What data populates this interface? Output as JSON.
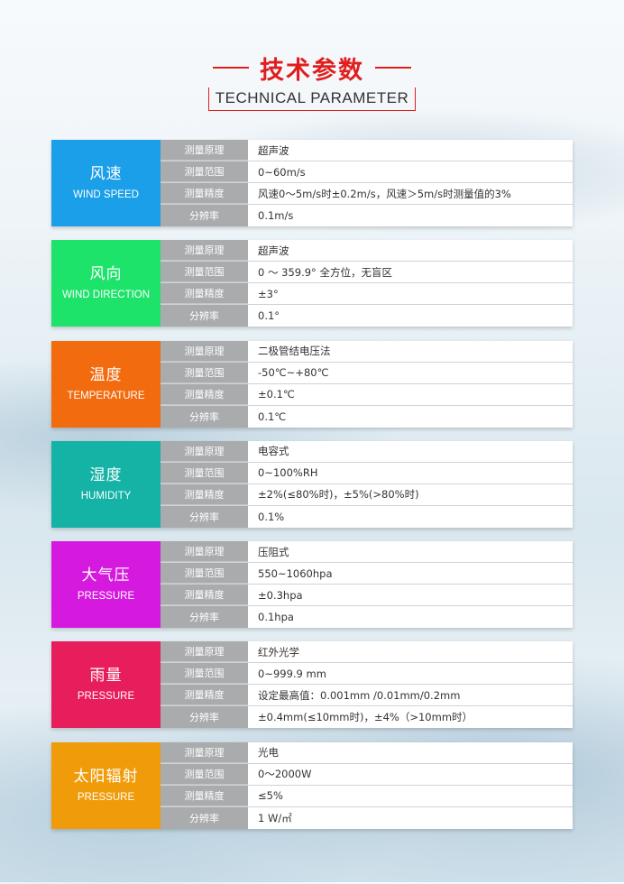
{
  "header": {
    "title_cn": "技术参数",
    "title_en": "TECHNICAL PARAMETER",
    "accent_color": "#e01e1e"
  },
  "blocks": [
    {
      "name_cn": "风速",
      "name_en": "WIND SPEED",
      "color": "#1a9fe8",
      "rows": [
        {
          "label": "测量原理",
          "value": "超声波"
        },
        {
          "label": "测量范围",
          "value": "0~60m/s"
        },
        {
          "label": "测量精度",
          "value": "风速0～5m/s时±0.2m/s，风速＞5m/s时测量值的3%"
        },
        {
          "label": "分辨率",
          "value": "0.1m/s"
        }
      ]
    },
    {
      "name_cn": "风向",
      "name_en": "WIND DIRECTION",
      "color": "#1ee36a",
      "rows": [
        {
          "label": "测量原理",
          "value": "超声波"
        },
        {
          "label": "测量范围",
          "value": "0 ～ 359.9° 全方位，无盲区"
        },
        {
          "label": "测量精度",
          "value": "±3°"
        },
        {
          "label": "分辨率",
          "value": "0.1°"
        }
      ]
    },
    {
      "name_cn": "温度",
      "name_en": "TEMPERATURE",
      "color": "#f26b0f",
      "rows": [
        {
          "label": "测量原理",
          "value": "二极管结电压法"
        },
        {
          "label": "测量范围",
          "value": "-50℃~+80℃"
        },
        {
          "label": "测量精度",
          "value": "±0.1℃"
        },
        {
          "label": "分辨率",
          "value": "0.1℃"
        }
      ]
    },
    {
      "name_cn": "湿度",
      "name_en": "HUMIDITY",
      "color": "#14b3a5",
      "rows": [
        {
          "label": "测量原理",
          "value": "电容式"
        },
        {
          "label": "测量范围",
          "value": "0~100%RH"
        },
        {
          "label": "测量精度",
          "value": "±2%(≤80%时)，±5%(>80%时)"
        },
        {
          "label": "分辨率",
          "value": "0.1%"
        }
      ]
    },
    {
      "name_cn": "大气压",
      "name_en": "PRESSURE",
      "color": "#d619de",
      "rows": [
        {
          "label": "测量原理",
          "value": "压阻式"
        },
        {
          "label": "测量范围",
          "value": "550~1060hpa"
        },
        {
          "label": "测量精度",
          "value": "±0.3hpa"
        },
        {
          "label": "分辨率",
          "value": "0.1hpa"
        }
      ]
    },
    {
      "name_cn": "雨量",
      "name_en": "PRESSURE",
      "color": "#e81d5b",
      "rows": [
        {
          "label": "测量原理",
          "value": "红外光学"
        },
        {
          "label": "测量范围",
          "value": "0~999.9 mm"
        },
        {
          "label": "测量精度",
          "value": "设定最高值：0.001mm /0.01mm/0.2mm"
        },
        {
          "label": "分辨率",
          "value": "±0.4mm(≤10mm时)，±4%（>10mm时）"
        }
      ]
    },
    {
      "name_cn": "太阳辐射",
      "name_en": "PRESSURE",
      "color": "#f09c0a",
      "rows": [
        {
          "label": "测量原理",
          "value": "光电"
        },
        {
          "label": "测量范围",
          "value": "0～2000W"
        },
        {
          "label": "测量精度",
          "value": "≤5%"
        },
        {
          "label": "分辨率",
          "value": "1 W/㎡"
        }
      ]
    }
  ]
}
